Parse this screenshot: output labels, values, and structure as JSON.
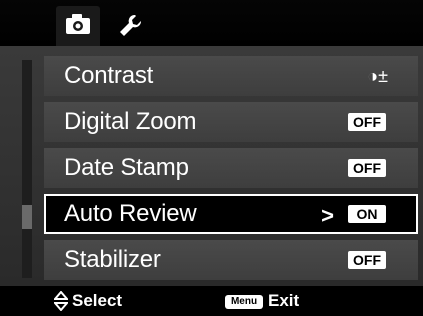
{
  "tabs": [
    {
      "name": "camera",
      "icon": "camera-icon",
      "active": true
    },
    {
      "name": "setup",
      "icon": "wrench-icon",
      "active": false
    }
  ],
  "menu": {
    "items": [
      {
        "label": "Contrast",
        "value": "◑±",
        "value_type": "icon"
      },
      {
        "label": "Digital Zoom",
        "value": "OFF",
        "value_type": "badge"
      },
      {
        "label": "Date Stamp",
        "value": "OFF",
        "value_type": "badge"
      },
      {
        "label": "Auto Review",
        "value": "ON",
        "value_type": "badge",
        "selected": true,
        "arrow": ">"
      },
      {
        "label": "Stabilizer",
        "value": "OFF",
        "value_type": "badge"
      }
    ]
  },
  "footer": {
    "select_label": "Select",
    "menu_key": "Menu",
    "exit_label": "Exit"
  },
  "colors": {
    "background": "#000000",
    "panel": "#333333",
    "item": "#444444",
    "text": "#ffffff"
  }
}
